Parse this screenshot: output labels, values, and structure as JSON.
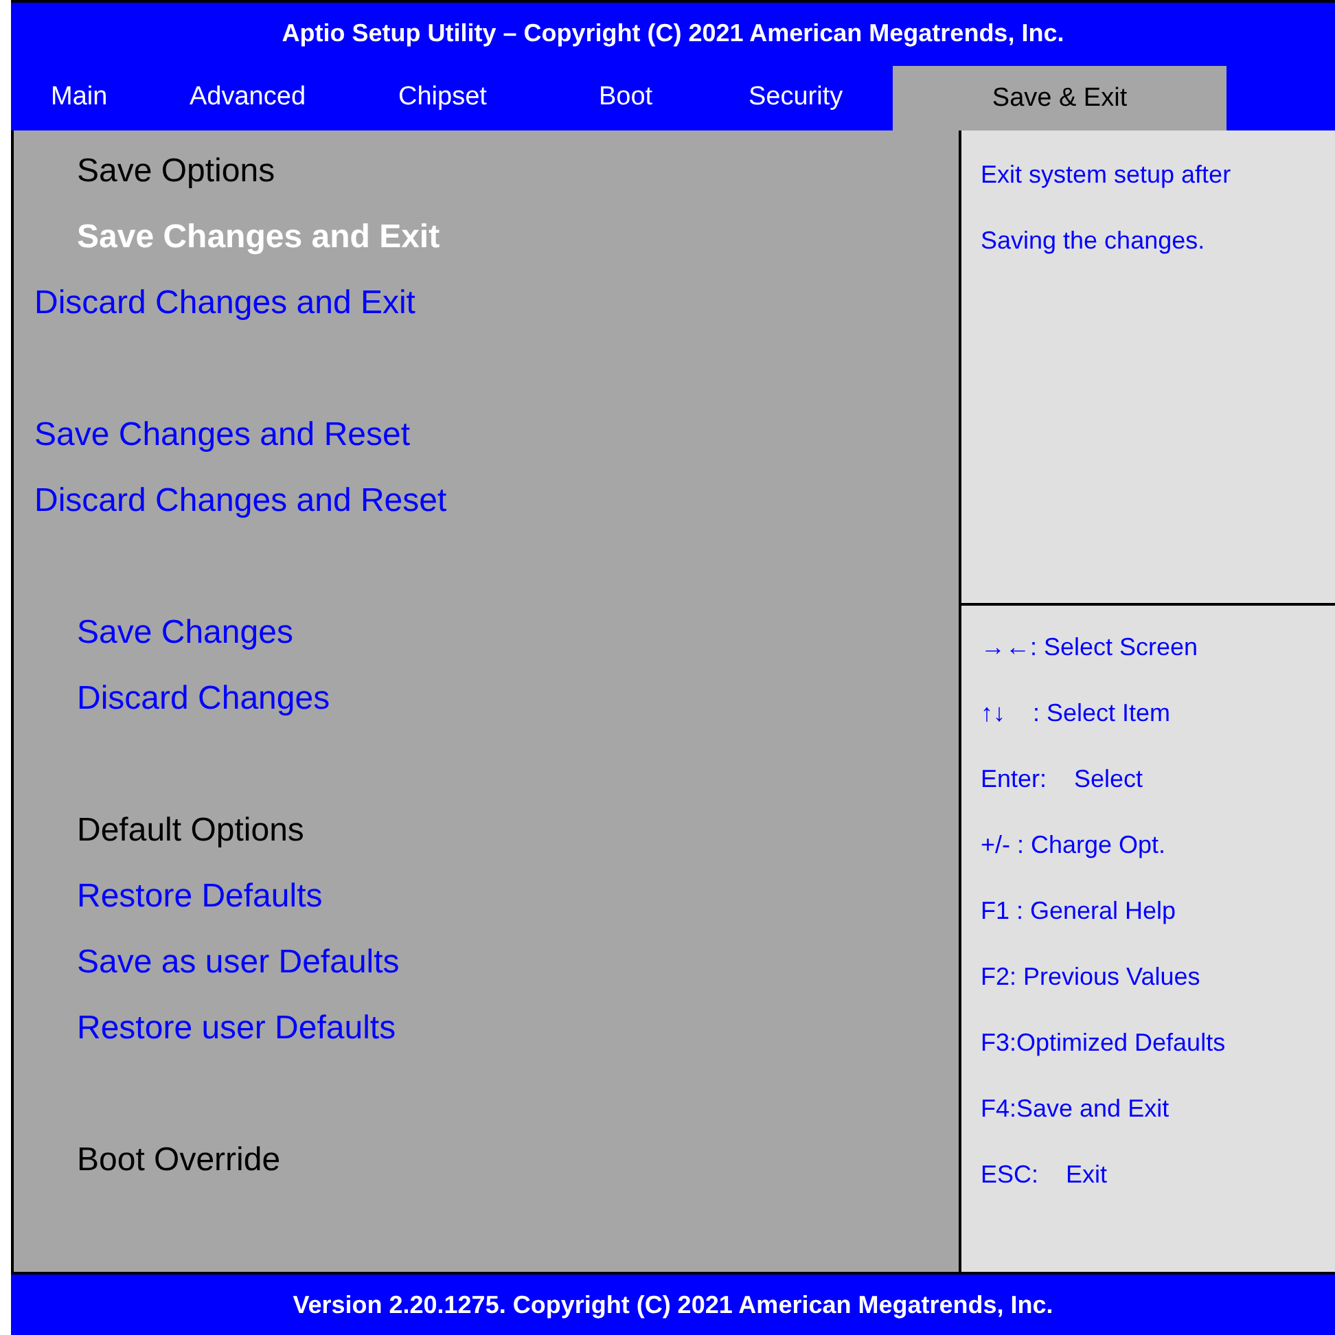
{
  "title_bar": {
    "title": "Aptio Setup Utility – Copyright (C) 2021 American Megatrends, Inc."
  },
  "tabs": [
    {
      "label": "Main",
      "selected": false
    },
    {
      "label": "Advanced",
      "selected": false
    },
    {
      "label": "Chipset",
      "selected": false
    },
    {
      "label": "Boot",
      "selected": false
    },
    {
      "label": "Security",
      "selected": false
    },
    {
      "label": "Save & Exit",
      "selected": true
    }
  ],
  "menu": [
    {
      "kind": "heading",
      "label": "Save Options",
      "indented": true,
      "gap_before": false,
      "selected": false
    },
    {
      "kind": "option",
      "label": "Save Changes and Exit",
      "indented": true,
      "gap_before": false,
      "selected": true
    },
    {
      "kind": "option",
      "label": "Discard Changes and Exit",
      "indented": false,
      "gap_before": false,
      "selected": false
    },
    {
      "kind": "option",
      "label": "Save Changes and Reset",
      "indented": false,
      "gap_before": true,
      "selected": false
    },
    {
      "kind": "option",
      "label": "Discard Changes and Reset",
      "indented": false,
      "gap_before": false,
      "selected": false
    },
    {
      "kind": "option",
      "label": "Save Changes",
      "indented": true,
      "gap_before": true,
      "selected": false
    },
    {
      "kind": "option",
      "label": "Discard Changes",
      "indented": true,
      "gap_before": false,
      "selected": false
    },
    {
      "kind": "heading",
      "label": "Default Options",
      "indented": true,
      "gap_before": true,
      "selected": false
    },
    {
      "kind": "option",
      "label": "Restore Defaults",
      "indented": true,
      "gap_before": false,
      "selected": false
    },
    {
      "kind": "option",
      "label": "Save as user Defaults",
      "indented": true,
      "gap_before": false,
      "selected": false
    },
    {
      "kind": "option",
      "label": "Restore user Defaults",
      "indented": true,
      "gap_before": false,
      "selected": false
    },
    {
      "kind": "heading",
      "label": "Boot Override",
      "indented": true,
      "gap_before": true,
      "selected": false
    }
  ],
  "help": {
    "lines": [
      "Exit system setup after",
      "Saving the changes."
    ]
  },
  "keys": [
    "→←: Select Screen",
    "↑↓    : Select Item",
    "Enter:    Select",
    "+/- : Charge Opt.",
    "F1 : General Help",
    "F2: Previous Values",
    "F3:Optimized Defaults",
    "F4:Save and Exit",
    "ESC:    Exit"
  ],
  "status_bar": {
    "text": "Version 2.20.1275. Copyright (C) 2021 American Megatrends, Inc."
  }
}
